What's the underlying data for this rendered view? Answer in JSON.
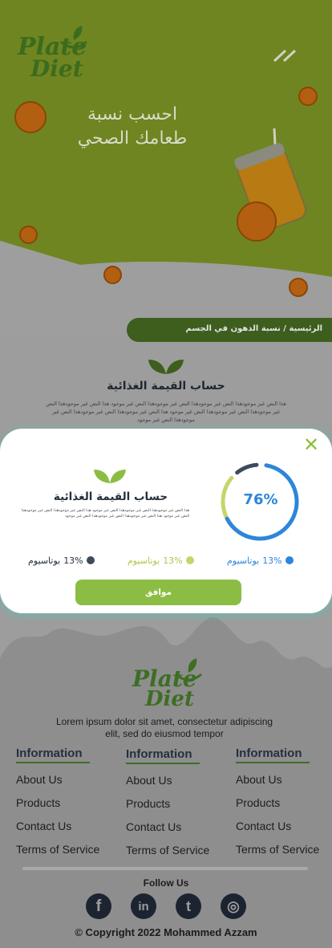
{
  "hero": {
    "logo_line1": "Plate",
    "logo_line2": "Diet",
    "title_line1": "احسب نسبة",
    "title_line2": "طعامك الصحي"
  },
  "breadcrumb": "الرئيسية / نسبة الدهون في الجسم",
  "section": {
    "title": "حساب القيمة الغذائية",
    "paragraph": "هذا النص غير موجودهذا النص غير موجودهذا النص غير موجودهذا النص غير موجود هذا النص غير موجودهذا النص غير موجودهذا النص غير موجودهذا النص غير موجود هذا النص غير موجودهذا النص غير موجودهذا النص غير موجودهذا النص غير موجود"
  },
  "modal": {
    "close": "✕",
    "title": "حساب القيمة الغذائية",
    "paragraph": "هذا النص غير موجودهذا النص غير موجودهذا النص غير موجود هذا النص غير موجودهذا النص غير موجودهذا النص غير موجود هذا النص غير موجودهذا النص غير موجودهذا النص غير موجود",
    "gauge_value": 76,
    "gauge_label": "76%",
    "legend": [
      {
        "label": "بوتاسيوم",
        "value": "13%",
        "color": "#2c86db"
      },
      {
        "label": "بوتاسيوم",
        "value": "13%",
        "color": "#c7d46b"
      },
      {
        "label": "بوتاسيوم",
        "value": "13%",
        "color": "#3d4a5c"
      }
    ],
    "ok_label": "موافق"
  },
  "footer": {
    "logo_line1": "Plate",
    "logo_line2": "Diet",
    "description": "Lorem ipsum dolor sit amet, consectetur adipiscing elit, sed do eiusmod tempor",
    "columns": [
      {
        "heading": "Information",
        "links": [
          "About Us",
          "Products",
          "Contact Us",
          "Terms of Service"
        ]
      },
      {
        "heading": "Information",
        "links": [
          "About Us",
          "Products",
          "Contact Us",
          "Terms of Service"
        ]
      },
      {
        "heading": "Information",
        "links": [
          "About Us",
          "Products",
          "Contact Us",
          "Terms of Service"
        ]
      }
    ],
    "follow_label": "Follow Us",
    "social": [
      {
        "icon": "facebook-icon",
        "glyph": "f"
      },
      {
        "icon": "linkedin-icon",
        "glyph": "in"
      },
      {
        "icon": "twitter-icon",
        "glyph": "t"
      },
      {
        "icon": "instagram-icon",
        "glyph": "◎"
      }
    ],
    "copyright": "© Copyright 2022 Mohammed Azzam"
  },
  "colors": {
    "accent_green": "#8bbd44",
    "dark_green": "#3d5e1d",
    "gauge_blue": "#2c86db",
    "gauge_lime": "#c7d46b",
    "gauge_dark": "#3d4a5c"
  }
}
